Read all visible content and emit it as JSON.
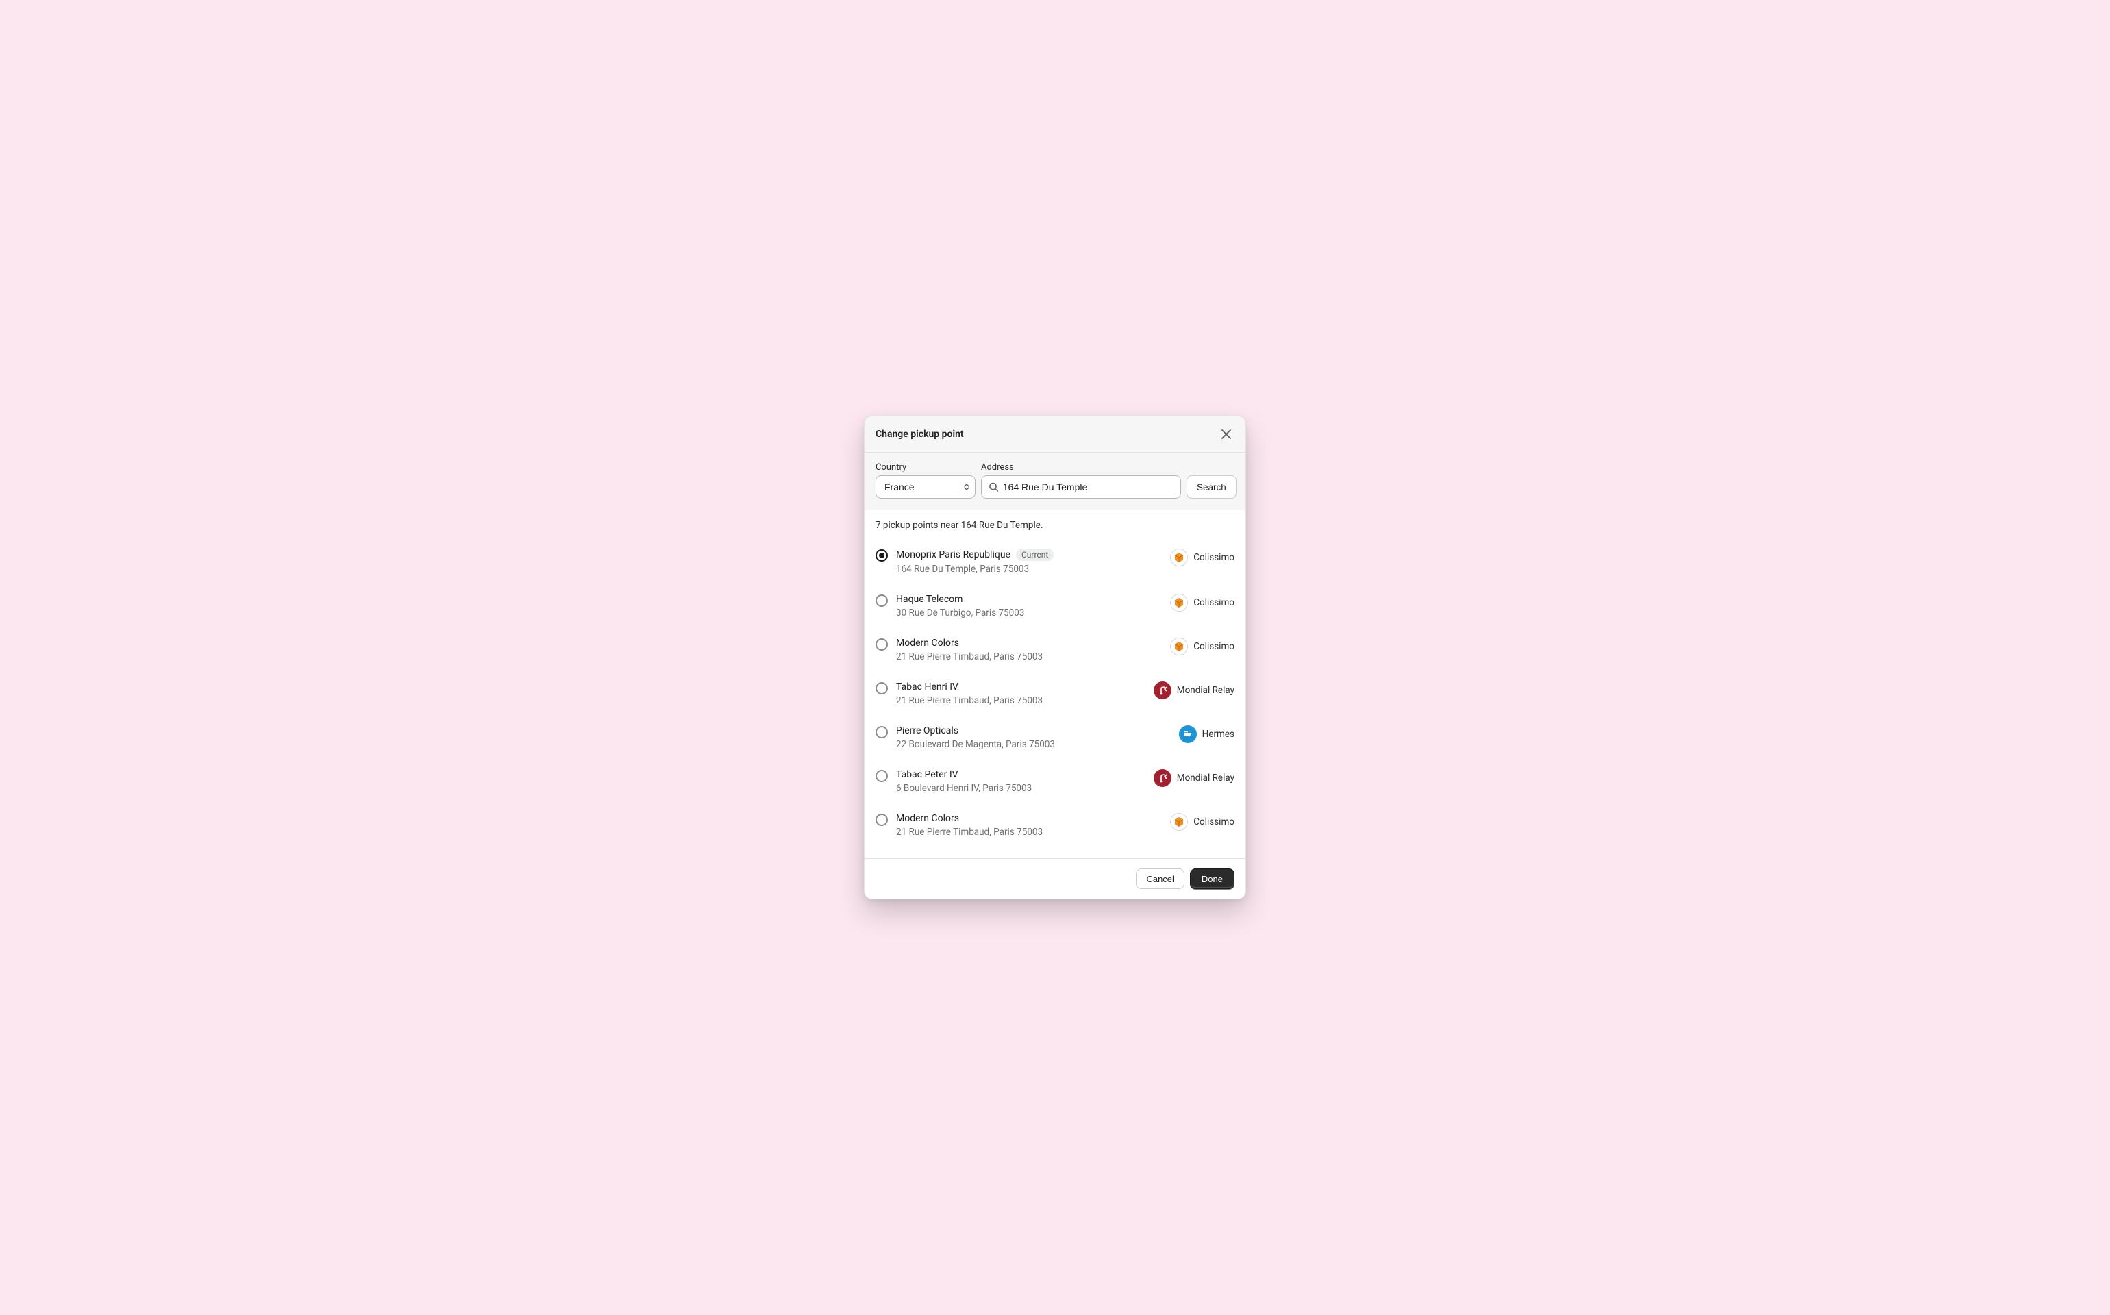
{
  "modal": {
    "title": "Change pickup point"
  },
  "search": {
    "country_label": "Country",
    "country_value": "France",
    "address_label": "Address",
    "address_value": "164 Rue Du Temple",
    "button": "Search",
    "results_caption": "7 pickup points near 164 Rue Du Temple."
  },
  "badges": {
    "current": "Current"
  },
  "carriers": {
    "colissimo": "Colissimo",
    "mondial_relay": "Mondial Relay",
    "hermes": "Hermes",
    "colors": {
      "colissimo_box": "#f29121",
      "mondial_bg": "#a3212f",
      "hermes_bg": "#1e93d6"
    }
  },
  "pickup_points": [
    {
      "name": "Monoprix Paris Republique",
      "address": "164 Rue Du Temple, Paris 75003",
      "carrier": "colissimo",
      "selected": true,
      "current": true
    },
    {
      "name": "Haque Telecom",
      "address": "30 Rue De Turbigo, Paris 75003",
      "carrier": "colissimo",
      "selected": false,
      "current": false
    },
    {
      "name": "Modern Colors",
      "address": "21 Rue Pierre Timbaud, Paris 75003",
      "carrier": "colissimo",
      "selected": false,
      "current": false
    },
    {
      "name": "Tabac Henri IV",
      "address": "21 Rue Pierre Timbaud, Paris 75003",
      "carrier": "mondial_relay",
      "selected": false,
      "current": false
    },
    {
      "name": "Pierre Opticals",
      "address": "22 Boulevard De Magenta, Paris 75003",
      "carrier": "hermes",
      "selected": false,
      "current": false
    },
    {
      "name": "Tabac Peter IV",
      "address": "6 Boulevard Henri IV, Paris 75003",
      "carrier": "mondial_relay",
      "selected": false,
      "current": false
    },
    {
      "name": "Modern Colors",
      "address": "21 Rue Pierre Timbaud, Paris 75003",
      "carrier": "colissimo",
      "selected": false,
      "current": false
    }
  ],
  "footer": {
    "cancel": "Cancel",
    "done": "Done"
  }
}
